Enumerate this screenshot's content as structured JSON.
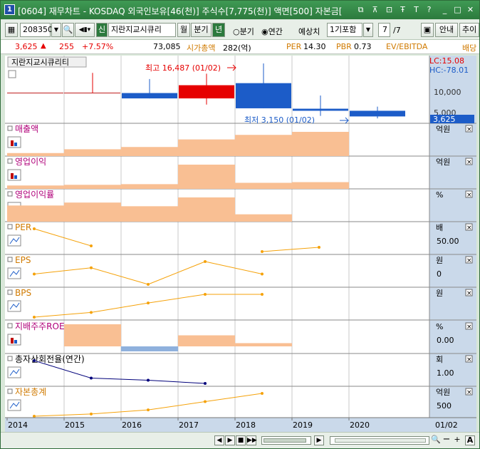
{
  "window": {
    "number": "1",
    "title": "[0604] 재무차트 - KOSDAQ 외국인보유[46(천)] 주식수[7,775(천)] 액면[500] 자본금[",
    "buttons": [
      "⧉",
      "↑",
      "⊡",
      "T",
      "T",
      "?",
      "_",
      "□",
      "×"
    ]
  },
  "toolbar": {
    "code": "208350",
    "shin_label": "신",
    "stock_name": "지란지교시큐리",
    "btn_month": "월",
    "btn_quarter": "분기",
    "btn_year": "년",
    "radio_quarter": "분기",
    "radio_annual": "연간",
    "forecast_label": "예상치",
    "forecast_value": "1기포함",
    "page_current": "7",
    "page_total": "/7",
    "btn_guide": "안내",
    "btn_add": "추이"
  },
  "pricebar": {
    "price": "3,625",
    "change": "255",
    "change_pct": "+7.57%",
    "volume": "73,085",
    "mktcap_label": "시가총액",
    "mktcap_value": "282(억)",
    "per_label": "PER",
    "per_value": "14.30",
    "pbr_label": "PBR",
    "pbr_value": "0.73",
    "ev_label": "EV/EBITDA",
    "div_label": "배당"
  },
  "colors": {
    "up": "#e60000",
    "down": "#1c5cc8",
    "bar": "#f9bf93",
    "line": "#f5a20a",
    "navy": "#00007a",
    "title_green": "#2c7a3d"
  },
  "main_panel": {
    "stock_label": "지란지교시큐리티",
    "high_label": "최고 16,487 (01/02)",
    "low_label": "최저 3,150 (01/02)",
    "lc_label": "LC:15.08",
    "hc_label": "HC:-78.01",
    "axis_ticks": [
      "10,000",
      "5,000"
    ],
    "current_price_tag": "3,625"
  },
  "chart_data": {
    "type": "bar",
    "categories": [
      "2014",
      "2015",
      "2016",
      "2017",
      "2018",
      "2019",
      "2020"
    ],
    "candles": [
      {
        "year": "2014",
        "open": 9300,
        "close": 9300,
        "high": 9300,
        "low": 9300
      },
      {
        "year": "2015",
        "open": 9300,
        "close": 9300,
        "high": 14200,
        "low": 9300
      },
      {
        "year": "2016",
        "open": 9300,
        "close": 8000,
        "high": 12700,
        "low": 8000
      },
      {
        "year": "2017",
        "open": 8000,
        "close": 11200,
        "high": 14000,
        "low": 6500
      },
      {
        "year": "2018",
        "open": 11700,
        "close": 5600,
        "high": 16487,
        "low": 5600
      },
      {
        "year": "2019",
        "open": 5500,
        "close": 5000,
        "high": 8700,
        "low": 3750
      },
      {
        "year": "2020",
        "open": 5000,
        "close": 3625,
        "high": 6000,
        "low": 3150
      }
    ],
    "panels": [
      {
        "name": "매출액",
        "unit": "억원",
        "kind": "bar",
        "values": [
          4,
          9,
          12,
          22,
          28,
          32
        ],
        "ticks": []
      },
      {
        "name": "영업이익",
        "unit": "억원",
        "kind": "bar",
        "values": [
          5,
          6,
          7,
          36,
          9,
          10
        ],
        "ticks": []
      },
      {
        "name": "영업이익률",
        "unit": "%",
        "kind": "bar",
        "values": [
          22,
          26,
          21,
          33,
          10,
          0
        ],
        "ticks": []
      },
      {
        "name": "PER",
        "unit": "배",
        "kind": "line",
        "values": [
          72,
          60,
          null,
          null,
          56,
          59
        ],
        "ticks": [
          "50.00"
        ]
      },
      {
        "name": "EPS",
        "unit": "원",
        "kind": "line",
        "values": [
          28,
          34,
          18,
          40,
          28,
          null
        ],
        "ticks": [
          "0"
        ]
      },
      {
        "name": "BPS",
        "unit": "원",
        "kind": "line",
        "values": [
          4,
          10,
          22,
          33,
          33,
          null
        ],
        "ticks": []
      },
      {
        "name": "지배주주ROE",
        "unit": "%",
        "kind": "bar_signed",
        "values": [
          null,
          8.2,
          -2.1,
          4.1,
          1.2,
          null
        ],
        "ticks": [
          "0.00"
        ]
      },
      {
        "name": "총자산회전율(연간)",
        "unit": "회",
        "kind": "line",
        "values": [
          1.45,
          1.12,
          1.08,
          1.02,
          null,
          null
        ],
        "ticks": [
          "1.00"
        ]
      },
      {
        "name": "자본총계",
        "unit": "억원",
        "kind": "line",
        "values": [
          6,
          13,
          26,
          52,
          78,
          null
        ],
        "ticks": [
          "500"
        ]
      }
    ],
    "xaxis_labels": [
      "2014",
      "2015",
      "2016",
      "2017",
      "2018",
      "2019",
      "2020"
    ],
    "date_label": "01/02"
  }
}
